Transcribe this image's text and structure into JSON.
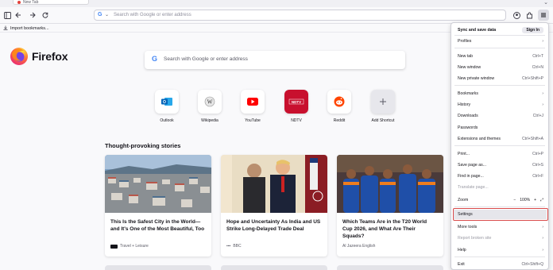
{
  "tab": {
    "title": "New Tab"
  },
  "urlbar": {
    "placeholder": "Search with Google or enter address"
  },
  "bookmarks": {
    "import_label": "Import bookmarks..."
  },
  "brand": {
    "name": "Firefox"
  },
  "search": {
    "placeholder": "Search with Google or enter address"
  },
  "shortcuts": [
    {
      "label": "Outlook",
      "icon": "outlook-icon"
    },
    {
      "label": "Wikipedia",
      "icon": "wikipedia-icon"
    },
    {
      "label": "YouTube",
      "icon": "youtube-icon"
    },
    {
      "label": "NDTV",
      "icon": "ndtv-icon"
    },
    {
      "label": "Reddit",
      "icon": "reddit-icon"
    },
    {
      "label": "Add Shortcut",
      "icon": "plus-icon"
    }
  ],
  "stories": {
    "title": "Thought-provoking stories",
    "cards": [
      {
        "title": "This Is the Safest City in the World—and It's One of the Most Beautiful, Too",
        "source": "Travel + Leisure"
      },
      {
        "title": "Hope and Uncertainty As India and US Strike Long-Delayed Trade Deal",
        "source": "BBC"
      },
      {
        "title": "Which Teams Are in the T20 World Cup 2026, and What Are Their Squads?",
        "source": "Al Jazeera English"
      }
    ]
  },
  "menu": {
    "sync_label": "Sync and save data",
    "signin_label": "Sign In",
    "profiles": "Profiles",
    "new_tab": "New tab",
    "new_tab_sc": "Ctrl+T",
    "new_window": "New window",
    "new_window_sc": "Ctrl+N",
    "new_private": "New private window",
    "new_private_sc": "Ctrl+Shift+P",
    "bookmarks": "Bookmarks",
    "history": "History",
    "downloads": "Downloads",
    "downloads_sc": "Ctrl+J",
    "passwords": "Passwords",
    "extensions": "Extensions and themes",
    "extensions_sc": "Ctrl+Shift+A",
    "print": "Print...",
    "print_sc": "Ctrl+P",
    "save_page": "Save page as...",
    "save_page_sc": "Ctrl+S",
    "find": "Find in page...",
    "find_sc": "Ctrl+F",
    "translate": "Translate page...",
    "zoom": "Zoom",
    "zoom_minus": "−",
    "zoom_level": "100%",
    "zoom_plus": "+",
    "settings": "Settings",
    "more_tools": "More tools",
    "report": "Report broken site",
    "help": "Help",
    "exit": "Exit",
    "exit_sc": "Ctrl+Shift+Q"
  },
  "colors": {
    "highlight": "#d94a4a",
    "accent": "#0060df"
  }
}
